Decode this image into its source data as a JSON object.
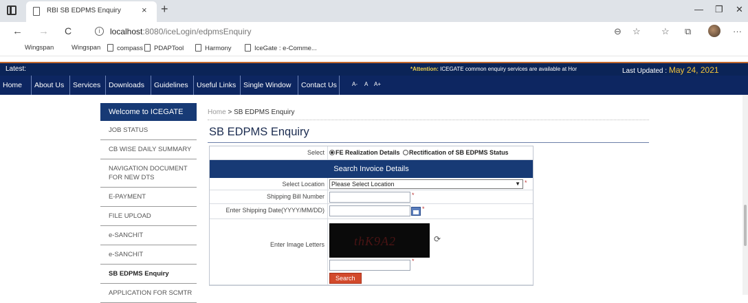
{
  "browser": {
    "tab_title": "RBI SB EDPMS Enquiry",
    "tab_close": "×",
    "new_tab": "+",
    "url_host": "localhost",
    "url_path": ":8080/iceLogin/edpmsEnquiry",
    "window_controls": [
      "—",
      "❐",
      "✕"
    ],
    "nav": {
      "back": "←",
      "forward": "→",
      "reload": "C"
    },
    "toolbar_icons": [
      "zoom-icon",
      "read-aloud-icon",
      "favorites-icon",
      "collections-icon",
      "profile-avatar",
      "more-icon"
    ],
    "toolbar_glyphs": {
      "zoom": "🔍",
      "star": "☆",
      "favs": "☆",
      "collections": "⧉",
      "more": "···"
    },
    "bookmarks": [
      "Wingspan",
      "Wingspan",
      "compass",
      "PDAPTool",
      "Harmony",
      "IceGate : e-Comme..."
    ]
  },
  "header": {
    "latest_label": "Latest:",
    "attention_prefix": "*Attention:",
    "attention_text": " ICEGATE common enquiry services are available at Hor",
    "last_updated_label": "Last Updated : ",
    "last_updated_date": "May 24, 2021",
    "nav_items": [
      "Home",
      "About Us",
      "Services",
      "Downloads",
      "Guidelines",
      "Useful Links",
      "Single Window",
      "Contact Us"
    ],
    "font_size_controls": [
      "A-",
      "A",
      "A+"
    ]
  },
  "sidebar": {
    "welcome": "Welcome to ICEGATE",
    "items": [
      "JOB STATUS",
      "CB WISE DAILY SUMMARY",
      "NAVIGATION DOCUMENT FOR NEW DTS",
      "E-PAYMENT",
      "FILE UPLOAD",
      "e-SANCHIT",
      "e-SANCHIT",
      "SB EDPMS Enquiry",
      "APPLICATION FOR SCMTR"
    ]
  },
  "content": {
    "breadcrumb_home": "Home",
    "breadcrumb_sep": " > ",
    "breadcrumb_current": "SB EDPMS Enquiry",
    "title": "SB EDPMS Enquiry",
    "form": {
      "select_label": "Select",
      "option_1": "FE Realization Details",
      "option_2": "Rectification of SB EDPMS Status",
      "section_title": "Search Invoice Details",
      "location_label": "Select Location",
      "location_value": "Please Select Location",
      "sb_number_label": "Shipping Bill Number",
      "sb_date_label": "Enter Shipping Date(YYYY/MM/DD)",
      "captcha_label": "Enter Image Letters",
      "captcha_text": "thK9A2",
      "required_mark": "*",
      "search_button": "Search"
    }
  }
}
